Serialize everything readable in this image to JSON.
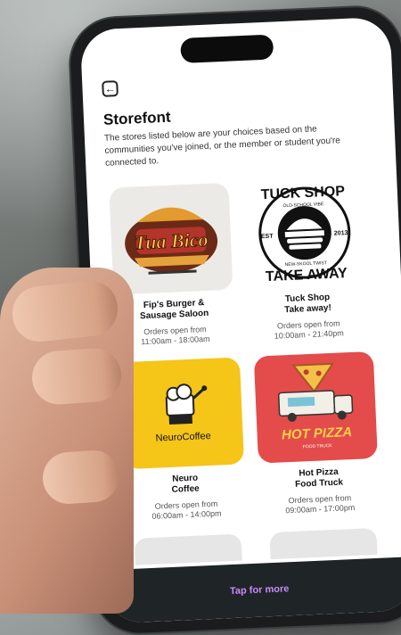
{
  "header": {
    "title": "Storefont"
  },
  "description": "The stores listed below are your choices based on the communities you've joined, or the member or student you're connected to.",
  "stores": [
    {
      "name": "Fip's Burger &\nSausage Saloon",
      "hours": "Orders open from\n11:00am - 18:00am",
      "logo_text": "Tua Bico"
    },
    {
      "name": "Tuck Shop\nTake away!",
      "hours": "Orders open from\n10:00am - 21:40pm",
      "logo_top": "TUCK SHOP",
      "logo_bottom": "TAKE AWAY",
      "logo_est": "EST",
      "logo_year": "2013",
      "logo_ring_top": "OLD-SCHOOL VIBE",
      "logo_ring_bottom": "NEW-SKOOL TWIST"
    },
    {
      "name": "Neuro\nCoffee",
      "hours": "Orders open from\n06:00am - 14:00pm",
      "logo_text": "NeuroCoffee"
    },
    {
      "name": "Hot Pizza\nFood Truck",
      "hours": "Orders open from\n09:00am - 17:00pm",
      "logo_text": "HOT PIZZA",
      "logo_sub": "FOOD TRUCK"
    }
  ],
  "footer": {
    "cta": "Tap for more"
  },
  "colors": {
    "accent": "#c98bff",
    "coffee_bg": "#f5c518",
    "pizza_bg": "#e44b4b",
    "bar_bg": "#1f2426"
  },
  "icons": {
    "back": "back-arrow-icon"
  }
}
